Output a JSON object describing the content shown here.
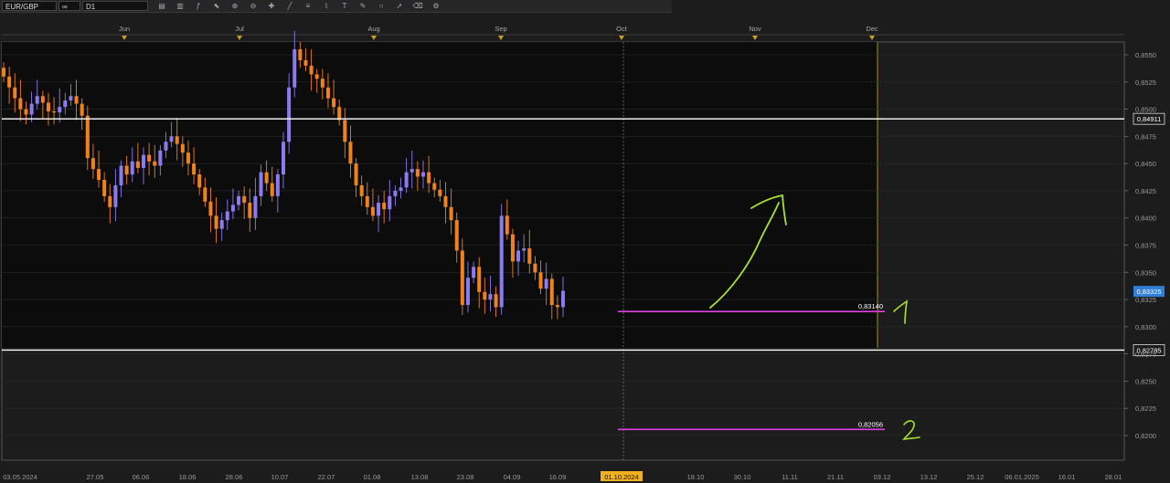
{
  "toolbar": {
    "symbol": "EUR/GBP",
    "link_icon": "link-icon",
    "timeframe": "D1",
    "tools": [
      "chart-type-icon",
      "candles-icon",
      "indicators-icon",
      "cursor-icon",
      "zoom-in-icon",
      "zoom-out-icon",
      "crosshair-icon",
      "line-icon",
      "channel-icon",
      "fib-icon",
      "text-icon",
      "pencil-icon",
      "shapes-icon",
      "arrow-icon",
      "eraser-icon",
      "settings-icon"
    ]
  },
  "colors": {
    "bull": "#8a7cf0",
    "bear": "#f0821e",
    "level_white": "#ffffff",
    "level_magenta": "#e040e0",
    "hand_green": "#a6e22e",
    "range_box": "#8a7a2a",
    "price_tag_blue": "#2f7fd8"
  },
  "chart_data": {
    "type": "candlestick",
    "title": "",
    "ylim": [
      0.819,
      0.8565
    ],
    "y_ticks": [
      "0,8550",
      "0,8525",
      "0,8500",
      "0,8475",
      "0,8450",
      "0,8425",
      "0,8400",
      "0,8375",
      "0,8350",
      "0,8325",
      "0,8300",
      "0,8275",
      "0,8250",
      "0,8225",
      "0,8200"
    ],
    "month_labels": [
      "Jun",
      "Jul",
      "Aug",
      "Sep",
      "Oct",
      "Nov",
      "Dec"
    ],
    "x_labels": [
      "03.05.2024",
      "27.05",
      "06.06",
      "18.06",
      "28.06",
      "10.07",
      "22.07",
      "01.08",
      "13.08",
      "23.08",
      "04.09",
      "16.09",
      "01.10.2024",
      "18.10",
      "30.10",
      "11.11",
      "21.11",
      "03.12",
      "13.12",
      "25.12",
      "06.01.2025",
      "16.01",
      "28.01"
    ],
    "highlighted_date": "01.10.2024",
    "price_tags": [
      {
        "label": "0,84911",
        "price": 0.84911,
        "style": "white"
      },
      {
        "label": "0,83325",
        "price": 0.83325,
        "style": "blue"
      },
      {
        "label": "0,82785",
        "price": 0.82785,
        "style": "white"
      }
    ],
    "levels": [
      {
        "label": "0,83140",
        "price": 0.8314,
        "annotation": "1"
      },
      {
        "label": "0,82056",
        "price": 0.82056,
        "annotation": "2"
      }
    ],
    "closes": [
      0.853,
      0.852,
      0.851,
      0.85,
      0.8495,
      0.8505,
      0.8512,
      0.8506,
      0.8498,
      0.8497,
      0.8502,
      0.8508,
      0.8512,
      0.8505,
      0.8494,
      0.8455,
      0.8445,
      0.8435,
      0.842,
      0.841,
      0.843,
      0.8448,
      0.844,
      0.8452,
      0.8446,
      0.8458,
      0.8452,
      0.8448,
      0.8462,
      0.847,
      0.8475,
      0.8468,
      0.846,
      0.845,
      0.844,
      0.8428,
      0.8415,
      0.8402,
      0.839,
      0.8398,
      0.8406,
      0.8412,
      0.842,
      0.8414,
      0.84,
      0.842,
      0.8442,
      0.8432,
      0.842,
      0.844,
      0.847,
      0.852,
      0.8555,
      0.8545,
      0.854,
      0.8532,
      0.8528,
      0.852,
      0.851,
      0.8502,
      0.849,
      0.847,
      0.845,
      0.843,
      0.842,
      0.841,
      0.8402,
      0.8414,
      0.8408,
      0.842,
      0.8425,
      0.8428,
      0.8442,
      0.8445,
      0.8438,
      0.8442,
      0.8432,
      0.8426,
      0.842,
      0.841,
      0.8398,
      0.837,
      0.832,
      0.8345,
      0.8355,
      0.8332,
      0.8325,
      0.833,
      0.8318,
      0.8402,
      0.8385,
      0.836,
      0.837,
      0.8372,
      0.8358,
      0.835,
      0.8335,
      0.8344,
      0.832,
      0.8318,
      0.8333
    ]
  },
  "annotations": {
    "level1_label": "1",
    "level2_label": "2"
  }
}
